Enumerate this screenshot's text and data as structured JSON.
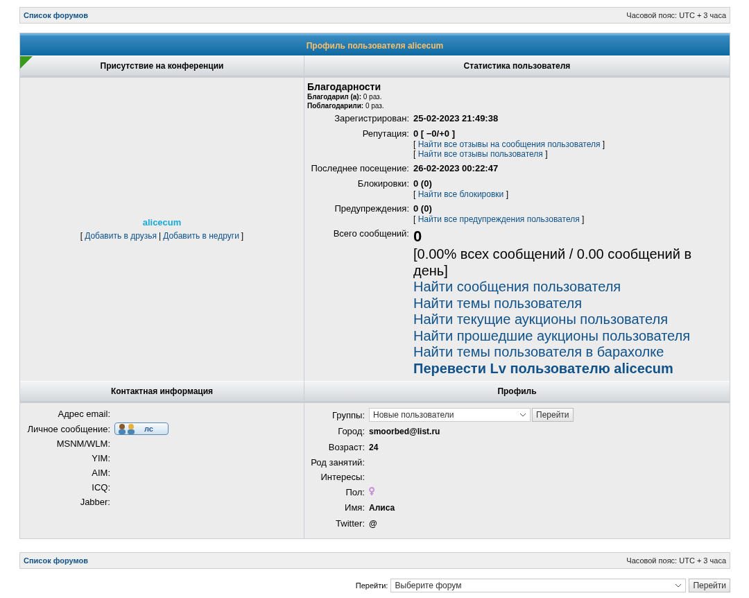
{
  "top_bar": {
    "link": "Список форумов",
    "timezone": "Часовой пояс: UTC + 3 часа"
  },
  "title": "Профиль пользователя alicecum",
  "left_header": "Присутствие на конференции",
  "right_header": "Статистика пользователя",
  "user": {
    "name": "alicecum",
    "open": "[",
    "links": [
      "Добавить в друзья",
      "Добавить в недруги"
    ],
    "separator": "|",
    "close": "]"
  },
  "thanks": {
    "title": "Благодарности",
    "lines": [
      {
        "label": "Благодарил (а):",
        "value": "0 раз."
      },
      {
        "label": "Поблагодарили:",
        "value": "0 раз."
      }
    ]
  },
  "stats": [
    {
      "kind": "plain",
      "label": "Зарегистрирован:",
      "value": "25-02-2023 21:49:38"
    },
    {
      "kind": "plain",
      "label": "Репутация:",
      "value": "0 [ −0/+0 ]",
      "links": [
        {
          "open": "[",
          "text": "Найти все отзывы на сообщения пользователя",
          "close": "]"
        },
        {
          "open": "[",
          "text": "Найти все отзывы пользователя",
          "close": "]"
        }
      ]
    },
    {
      "kind": "plain",
      "label": "Последнее посещение:",
      "value": "26-02-2023 00:22:47"
    },
    {
      "kind": "plain",
      "label": "Блокировки:",
      "value": "0 (0)",
      "links": [
        {
          "open": "[",
          "text": "Найти все блокировки",
          "close": "]"
        }
      ]
    },
    {
      "kind": "plain",
      "label": "Предупреждения:",
      "value": "0 (0)",
      "links": [
        {
          "open": "[",
          "text": "Найти все предупреждения пользователя",
          "close": "]"
        }
      ]
    },
    {
      "kind": "large",
      "label": "Всего сообщений:",
      "value": "0",
      "note": "[0.00% всех сообщений / 0.00 сообщений в день]",
      "links": [
        "Найти сообщения пользователя",
        "Найти темы пользователя",
        "Найти текущие аукционы пользователя",
        "Найти прошедшие аукционы пользователя",
        "Найти темы пользователя в барахолке"
      ],
      "bold_link": "Перевести Lv пользователю alicecum"
    }
  ],
  "contact_header": "Контактная информация",
  "profile_header": "Профиль",
  "contact": [
    {
      "kind": "text",
      "label": "Адрес email:"
    },
    {
      "kind": "pm",
      "label": "Личное сообщение:",
      "button": "лс"
    },
    {
      "kind": "text",
      "label": "MSNM/WLM:"
    },
    {
      "kind": "text",
      "label": "YIM:"
    },
    {
      "kind": "text",
      "label": "AIM:"
    },
    {
      "kind": "text",
      "label": "ICQ:"
    },
    {
      "kind": "text",
      "label": "Jabber:"
    }
  ],
  "profile": [
    {
      "kind": "select",
      "label": "Группы:",
      "value": "Новые пользователи",
      "button": "Перейти"
    },
    {
      "kind": "text",
      "label": "Город:",
      "value": "smoorbed@list.ru"
    },
    {
      "kind": "text",
      "label": "Возраст:",
      "value": "24"
    },
    {
      "kind": "text",
      "label": "Род занятий:"
    },
    {
      "kind": "text",
      "label": "Интересы:"
    },
    {
      "kind": "gender",
      "label": "Пол:"
    },
    {
      "kind": "text",
      "label": "Имя:",
      "value": "Алиса"
    },
    {
      "kind": "text",
      "label": "Twitter:",
      "value": "@"
    }
  ],
  "bottom_bar": {
    "link": "Список форумов",
    "timezone": "Часовой пояс: UTC + 3 часа"
  },
  "jump": {
    "label": "Перейти:",
    "value": "Выберите форум",
    "button": "Перейти"
  }
}
